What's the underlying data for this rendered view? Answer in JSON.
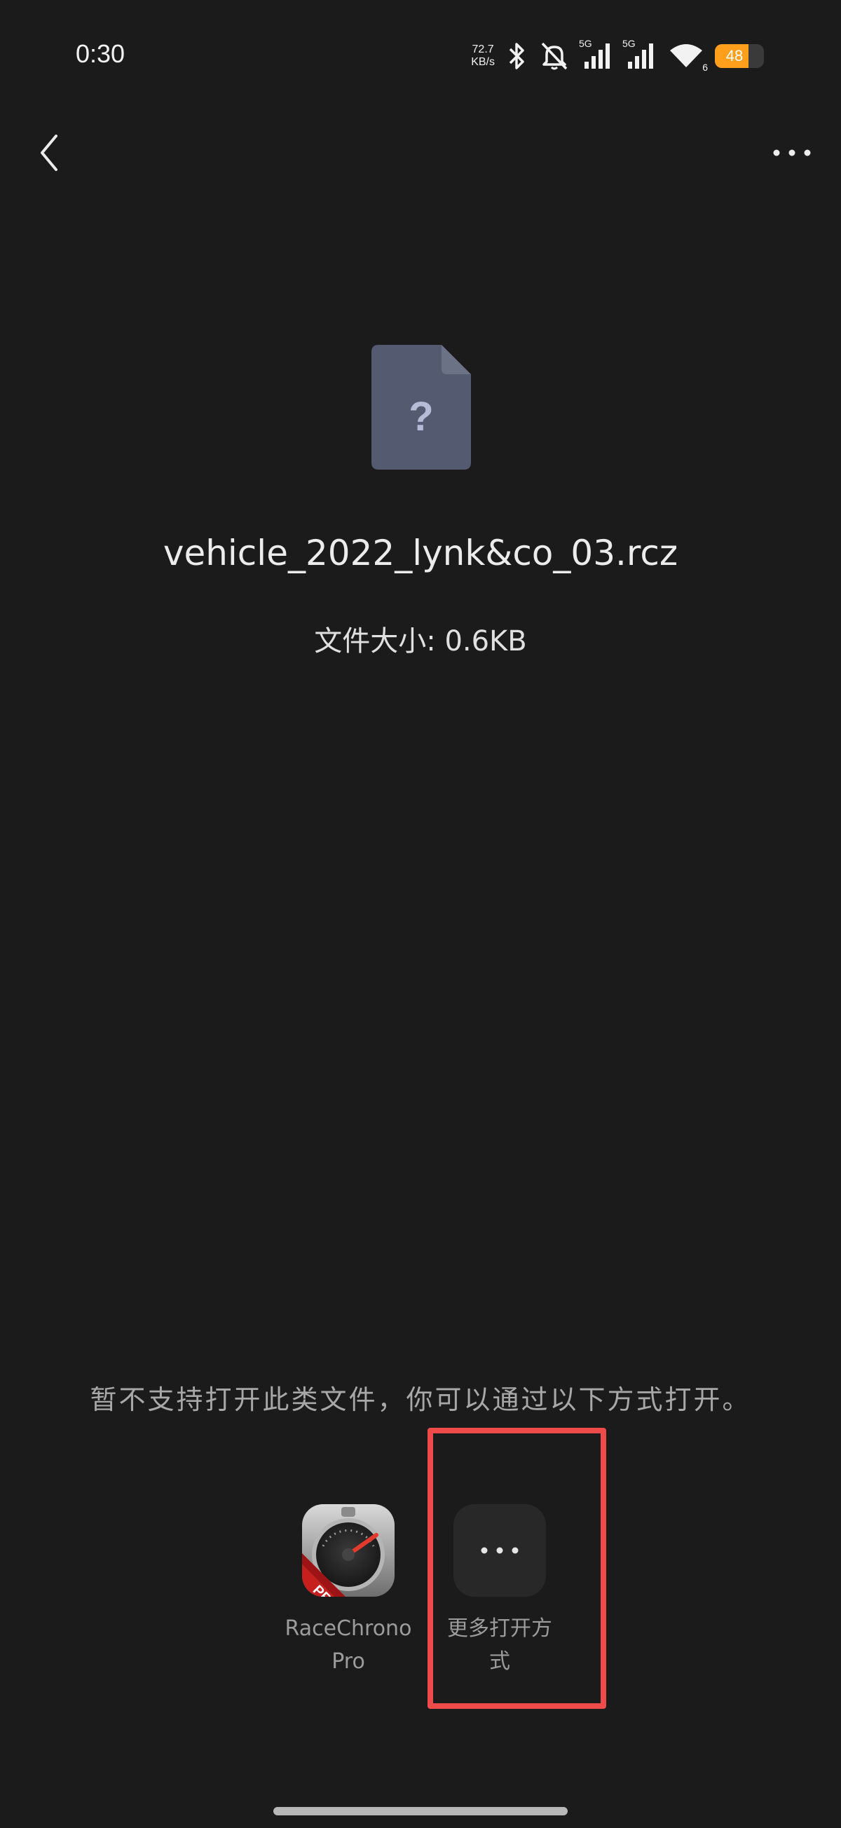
{
  "status_bar": {
    "time": "0:30",
    "net_speed_value": "72.7",
    "net_speed_unit": "KB/s",
    "signal_1_label": "5G",
    "signal_2_label": "5G",
    "wifi_label": "6",
    "battery_level": "48",
    "battery_fraction": 0.68,
    "battery_color": "#ff9f1c"
  },
  "top_bar": {
    "back_icon": "chevron-left-icon",
    "more_icon": "more-horizontal-icon"
  },
  "file": {
    "icon": "unknown-file-icon",
    "icon_glyph": "?",
    "name": "vehicle_2022_lynk&co_03.rcz",
    "size_label": "文件大小: 0.6KB"
  },
  "message": "暂不支持打开此类文件，你可以通过以下方式打开。",
  "open_options": [
    {
      "label_line1": "RaceChrono",
      "label_line2": "Pro",
      "icon": "racechrono-pro-icon",
      "badge": "PRO"
    },
    {
      "label_line1": "更多打开方",
      "label_line2": "式",
      "icon": "more-dots-icon"
    }
  ],
  "highlight_color": "#ef4b4b"
}
